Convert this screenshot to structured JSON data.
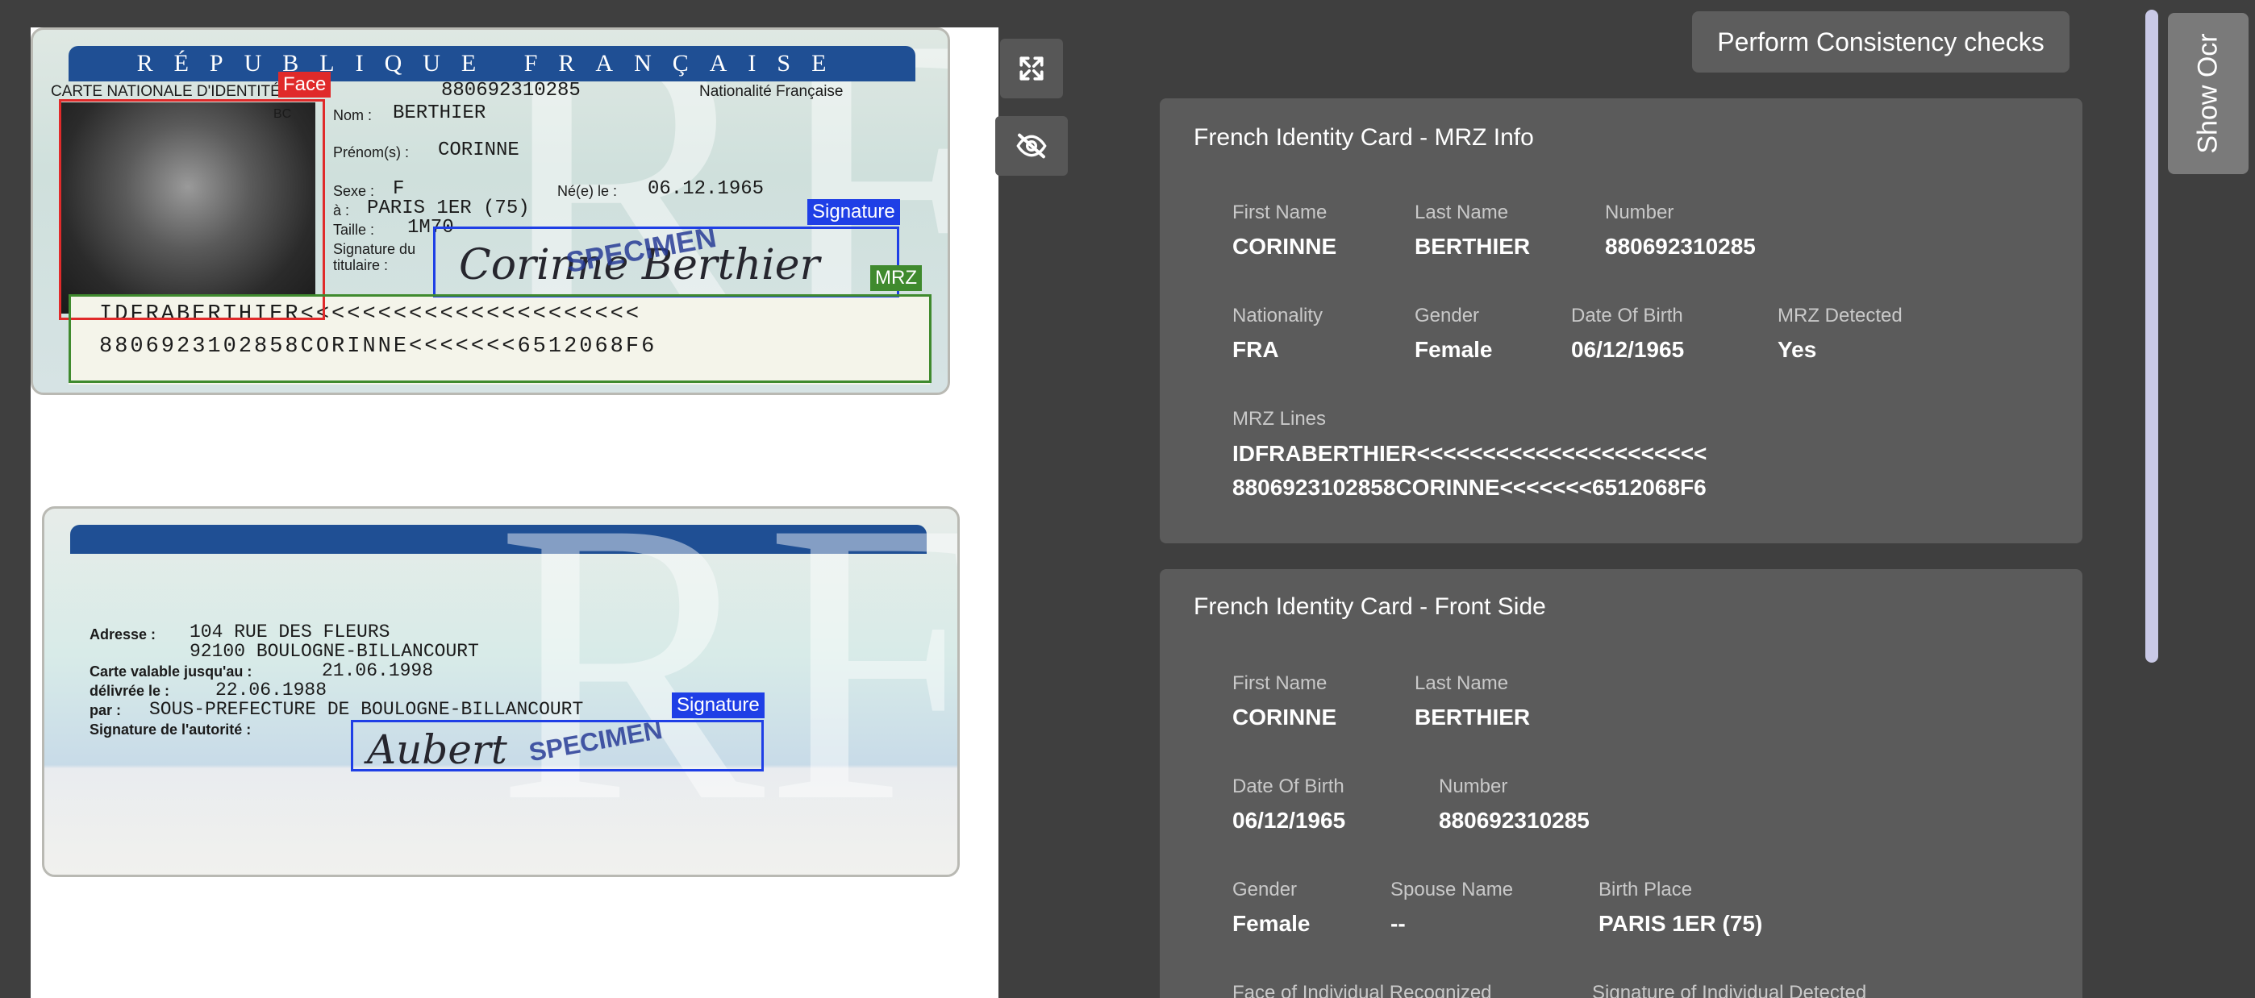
{
  "front_card": {
    "header": "RÉPUBLIQUE FRANÇAISE",
    "carte_line": "CARTE NATIONALE D'IDENTITÉ N° :",
    "number": "880692310285",
    "nationality": "Nationalité Française",
    "nom_label": "Nom :",
    "nom": "BERTHIER",
    "prenom_label": "Prénom(s) :",
    "prenom": "CORINNE",
    "sexe_label": "Sexe :",
    "sexe": "F",
    "nee_label": "Né(e) le :",
    "nee": "06.12.1965",
    "a_label": "à :",
    "birthplace": "PARIS 1ER (75)",
    "taille_label": "Taille :",
    "taille": "1M70",
    "sig_label": "Signature du titulaire :",
    "photo_code": "BC",
    "signature_ink": "Corinne Berthier",
    "specimen": "SPECIMEN",
    "mrz_line1": "IDFRABERTHIER<<<<<<<<<<<<<<<<<<<<<<",
    "mrz_line2": "8806923102858CORINNE<<<<<<<6512068F6"
  },
  "back_card": {
    "adresse_label": "Adresse :",
    "adresse1": "104 RUE DES FLEURS",
    "adresse2": "92100 BOULOGNE-BILLANCOURT",
    "valable_label": "Carte valable jusqu'au :",
    "valable": "21.06.1998",
    "delivree_label": "délivrée le :",
    "delivree": "22.06.1988",
    "par_label": "par :",
    "par": "SOUS-PREFECTURE DE BOULOGNE-BILLANCOURT",
    "sig_label": "Signature de l'autorité :",
    "signature_ink": "Aubert",
    "specimen": "SPECIMEN"
  },
  "detections": {
    "face": "Face",
    "signature": "Signature",
    "mrz": "MRZ",
    "colors": {
      "face": "#e02a2a",
      "signature": "#1f3fe6",
      "mrz": "#3f8a2e"
    }
  },
  "tools": {
    "expand_icon": "expand-arrows-icon",
    "hide_icon": "eye-slash-icon"
  },
  "consistency_button": "Perform Consistency checks",
  "show_ocr": "Show Ocr",
  "mrz_panel": {
    "title": "French Identity Card - MRZ Info",
    "first_name_label": "First Name",
    "first_name": "CORINNE",
    "last_name_label": "Last Name",
    "last_name": "BERTHIER",
    "number_label": "Number",
    "number": "880692310285",
    "nationality_label": "Nationality",
    "nationality": "FRA",
    "gender_label": "Gender",
    "gender": "Female",
    "dob_label": "Date Of Birth",
    "dob": "06/12/1965",
    "mrz_detected_label": "MRZ Detected",
    "mrz_detected": "Yes",
    "mrz_lines_label": "MRZ Lines",
    "mrz_line1": "IDFRABERTHIER<<<<<<<<<<<<<<<<<<<<<<",
    "mrz_line2": "8806923102858CORINNE<<<<<<<6512068F6"
  },
  "front_panel": {
    "title": "French Identity Card - Front Side",
    "first_name_label": "First Name",
    "first_name": "CORINNE",
    "last_name_label": "Last Name",
    "last_name": "BERTHIER",
    "dob_label": "Date Of Birth",
    "dob": "06/12/1965",
    "number_label": "Number",
    "number": "880692310285",
    "gender_label": "Gender",
    "gender": "Female",
    "spouse_label": "Spouse Name",
    "spouse": "--",
    "birthplace_label": "Birth Place",
    "birthplace": "PARIS 1ER (75)",
    "face_recognized_label": "Face of Individual Recognized",
    "signature_detected_label": "Signature of Individual Detected"
  }
}
